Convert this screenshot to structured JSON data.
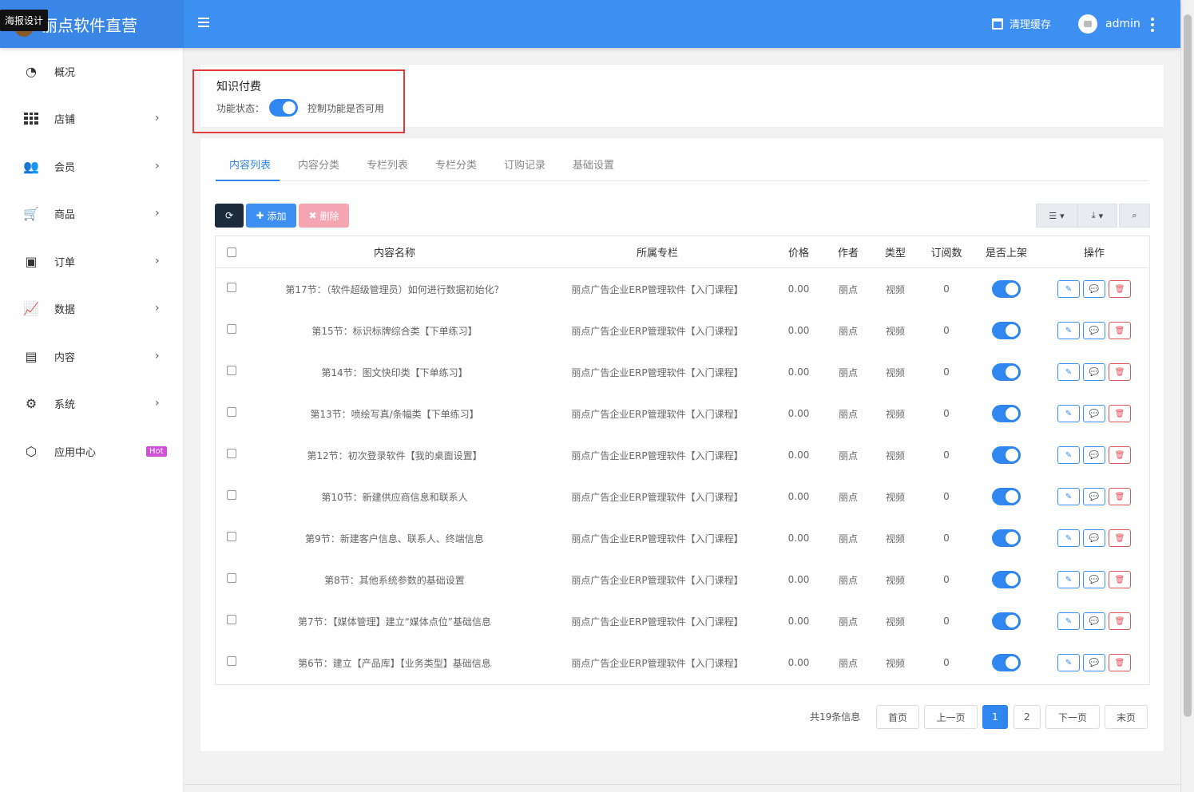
{
  "app": {
    "title": "丽点软件直营",
    "tooltip": "海报设计",
    "clear_cache": "清理缓存",
    "username": "admin"
  },
  "sidebar": {
    "items": [
      {
        "label": "概况",
        "icon": "dashboard-icon",
        "arrow": ""
      },
      {
        "label": "店铺",
        "icon": "grid-icon",
        "arrow": "›"
      },
      {
        "label": "会员",
        "icon": "users-icon",
        "arrow": "›"
      },
      {
        "label": "商品",
        "icon": "cart-icon",
        "arrow": "›"
      },
      {
        "label": "订单",
        "icon": "money-icon",
        "arrow": "›"
      },
      {
        "label": "数据",
        "icon": "chart-line-icon",
        "arrow": "›"
      },
      {
        "label": "内容",
        "icon": "document-icon",
        "arrow": "›"
      },
      {
        "label": "系统",
        "icon": "gear-icon",
        "arrow": "›"
      },
      {
        "label": "应用中心",
        "icon": "cube-icon",
        "badge": "Hot"
      }
    ]
  },
  "feature": {
    "title": "知识付费",
    "status_label": "功能状态：",
    "status_on": true,
    "status_hint": "控制功能是否可用"
  },
  "tabs": [
    "内容列表",
    "内容分类",
    "专栏列表",
    "专栏分类",
    "订购记录",
    "基础设置"
  ],
  "toolbar": {
    "add_label": "添加",
    "delete_label": "删除"
  },
  "table": {
    "headers": [
      "内容名称",
      "所属专栏",
      "价格",
      "作者",
      "类型",
      "订阅数",
      "是否上架",
      "操作"
    ],
    "rows": [
      {
        "name": "第17节：（软件超级管理员）如何进行数据初始化？",
        "column": "丽点广告企业ERP管理软件【入门课程】",
        "price": "0.00",
        "author": "丽点",
        "type": "视频",
        "subs": "0",
        "listed": true
      },
      {
        "name": "第15节：标识标牌综合类【下单练习】",
        "column": "丽点广告企业ERP管理软件【入门课程】",
        "price": "0.00",
        "author": "丽点",
        "type": "视频",
        "subs": "0",
        "listed": true
      },
      {
        "name": "第14节：图文快印类【下单练习】",
        "column": "丽点广告企业ERP管理软件【入门课程】",
        "price": "0.00",
        "author": "丽点",
        "type": "视频",
        "subs": "0",
        "listed": true
      },
      {
        "name": "第13节：喷绘写真/条幅类【下单练习】",
        "column": "丽点广告企业ERP管理软件【入门课程】",
        "price": "0.00",
        "author": "丽点",
        "type": "视频",
        "subs": "0",
        "listed": true
      },
      {
        "name": "第12节：初次登录软件【我的桌面设置】",
        "column": "丽点广告企业ERP管理软件【入门课程】",
        "price": "0.00",
        "author": "丽点",
        "type": "视频",
        "subs": "0",
        "listed": true
      },
      {
        "name": "第10节：新建供应商信息和联系人",
        "column": "丽点广告企业ERP管理软件【入门课程】",
        "price": "0.00",
        "author": "丽点",
        "type": "视频",
        "subs": "0",
        "listed": true
      },
      {
        "name": "第9节：新建客户信息、联系人、终端信息",
        "column": "丽点广告企业ERP管理软件【入门课程】",
        "price": "0.00",
        "author": "丽点",
        "type": "视频",
        "subs": "0",
        "listed": true
      },
      {
        "name": "第8节：其他系统参数的基础设置",
        "column": "丽点广告企业ERP管理软件【入门课程】",
        "price": "0.00",
        "author": "丽点",
        "type": "视频",
        "subs": "0",
        "listed": true
      },
      {
        "name": "第7节：【媒体管理】建立“媒体点位”基础信息",
        "column": "丽点广告企业ERP管理软件【入门课程】",
        "price": "0.00",
        "author": "丽点",
        "type": "视频",
        "subs": "0",
        "listed": true
      },
      {
        "name": "第6节：建立【产品库】【业务类型】基础信息",
        "column": "丽点广告企业ERP管理软件【入门课程】",
        "price": "0.00",
        "author": "丽点",
        "type": "视频",
        "subs": "0",
        "listed": true
      }
    ]
  },
  "pagination": {
    "info": "共19条信息",
    "first": "首页",
    "prev": "上一页",
    "pages": [
      "1",
      "2"
    ],
    "current": "1",
    "next": "下一页",
    "last": "末页"
  },
  "colors": {
    "primary": "#3d8ff2",
    "highlight": "#e23b3b",
    "danger": "#e8505b",
    "hot": "#d04fd9"
  }
}
